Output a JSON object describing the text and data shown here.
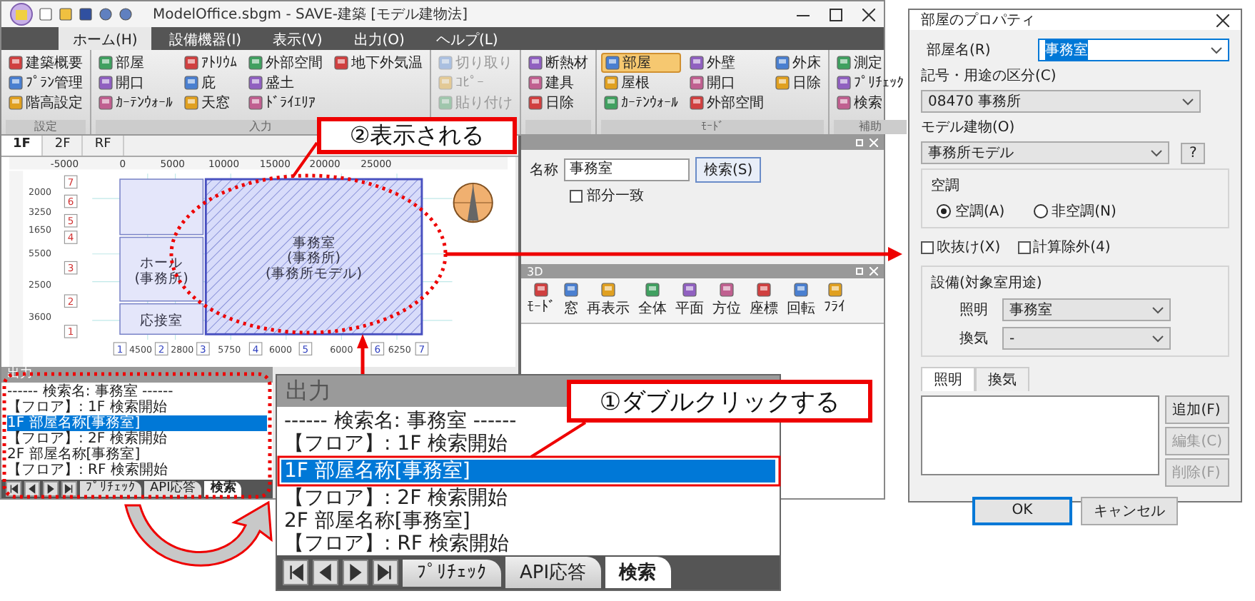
{
  "app": {
    "title": "ModelOffice.sbgm - SAVE-建築 [モデル建物法]",
    "menu_tabs": [
      {
        "label": "ホーム(H)",
        "selected": true
      },
      {
        "label": "設備機器(I)",
        "selected": false
      },
      {
        "label": "表示(V)",
        "selected": false
      },
      {
        "label": "出力(O)",
        "selected": false
      },
      {
        "label": "ヘルプ(L)",
        "selected": false
      }
    ],
    "ribbon": [
      {
        "label": "設定",
        "disabled": false,
        "items": [
          {
            "label": "建築概要"
          },
          {
            "label": "ﾌﾟﾗﾝ管理"
          },
          {
            "label": "階高設定"
          }
        ]
      },
      {
        "label": "入力",
        "disabled": false,
        "items": [
          {
            "label": "部屋"
          },
          {
            "label": "開口"
          },
          {
            "label": "ｶｰﾃﾝｳｫｰﾙ"
          },
          {
            "label": "ｱﾄﾘｳﾑ"
          },
          {
            "label": "庇"
          },
          {
            "label": "天窓"
          },
          {
            "label": "外部空間"
          },
          {
            "label": "盛土"
          },
          {
            "label": "ﾄﾞﾗｲｴﾘｱ"
          },
          {
            "label": "地下外気温"
          }
        ]
      },
      {
        "disabled": true,
        "items": [
          {
            "label": "切り取り"
          },
          {
            "label": "ｺﾋﾟｰ"
          },
          {
            "label": "貼り付け"
          }
        ]
      },
      {
        "disabled": false,
        "items": [
          {
            "label": "断熱材"
          },
          {
            "label": "建具"
          },
          {
            "label": "日除"
          }
        ]
      },
      {
        "label": "ﾓｰﾄﾞ",
        "disabled": false,
        "items": [
          {
            "label": "部屋",
            "selected": true
          },
          {
            "label": "屋根",
            "selected": false
          },
          {
            "label": "ｶｰﾃﾝｳｫｰﾙ",
            "selected": false
          },
          {
            "label": "外壁",
            "selected": false
          },
          {
            "label": "開口",
            "selected": false
          },
          {
            "label": "外部空間",
            "selected": false
          },
          {
            "label": "外床",
            "selected": false
          },
          {
            "label": "日除",
            "selected": false
          }
        ]
      },
      {
        "label": "補助",
        "disabled": false,
        "items": [
          {
            "label": "測定"
          },
          {
            "label": "ﾌﾟﾘﾁｪｯｸ"
          },
          {
            "label": "検索"
          }
        ]
      }
    ],
    "floor_tabs": [
      {
        "label": "1F",
        "selected": true
      },
      {
        "label": "2F",
        "selected": false
      },
      {
        "label": "RF",
        "selected": false
      }
    ],
    "plan": {
      "ruler": [
        "-5000",
        "0",
        "5000",
        "10000",
        "15000",
        "20000",
        "25000"
      ],
      "row_markers": [
        "7",
        "6",
        "5",
        "4",
        "3",
        "2",
        "1"
      ],
      "row_dims": [
        "2000",
        "3250",
        "1650",
        "5500",
        "2500",
        "3600"
      ],
      "col_markers": [
        "1",
        "2",
        "3",
        "4",
        "5",
        "6",
        "7"
      ],
      "col_dims": [
        "4500",
        "2800",
        "5750",
        "6000",
        "6000",
        "6250"
      ],
      "rooms": [
        {
          "selected": false
        },
        {
          "labels": [
            "ホール",
            "(事務所)"
          ],
          "selected": false
        },
        {
          "labels": [
            "応接室"
          ],
          "selected": false
        },
        {
          "labels": [
            "事務室",
            "(事務所)",
            "(事務所モデル)"
          ],
          "selected": true
        }
      ]
    },
    "output_panel": {
      "title": "出力",
      "lines": [
        {
          "text": "------ 検索名: 事務室 ------",
          "selected": false
        },
        {
          "text": "【フロア】: 1F 検索開始",
          "selected": false
        },
        {
          "text": "1F 部屋名称[事務室]",
          "selected": true
        },
        {
          "text": "【フロア】: 2F 検索開始",
          "selected": false
        },
        {
          "text": "2F 部屋名称[事務室]",
          "selected": false
        },
        {
          "text": "【フロア】: RF 検索開始",
          "selected": false
        }
      ],
      "tabs": [
        {
          "label": "ﾌﾟﾘﾁｪｯｸ",
          "selected": false
        },
        {
          "label": "API応答",
          "selected": false
        },
        {
          "label": "検索",
          "selected": true
        }
      ]
    },
    "search_pane": {
      "label": "名称",
      "value": "事務室",
      "button": "検索(S)",
      "option": {
        "label": "部分一致",
        "checked": false
      }
    },
    "view_3d": {
      "title": "3D",
      "tools": [
        "ﾓｰﾄﾞ",
        "窓",
        "再表示",
        "全体",
        "平面",
        "方位",
        "座標",
        "回転",
        "ﾌﾗｲ"
      ]
    }
  },
  "output_zoom": {
    "title": "出力",
    "lines": [
      {
        "text": "------ 検索名: 事務室 ------",
        "selected": false
      },
      {
        "text": "【フロア】: 1F 検索開始",
        "selected": false
      },
      {
        "text": "1F 部屋名称[事務室]",
        "selected": true
      },
      {
        "text": "【フロア】: 2F 検索開始",
        "selected": false
      },
      {
        "text": "2F 部屋名称[事務室]",
        "selected": false
      },
      {
        "text": "【フロア】: RF 検索開始",
        "selected": false
      }
    ],
    "tabs": [
      {
        "label": "ﾌﾟﾘﾁｪｯｸ",
        "selected": false
      },
      {
        "label": "API応答",
        "selected": false
      },
      {
        "label": "検索",
        "selected": true
      }
    ]
  },
  "dialog": {
    "title": "部屋のプロパティ",
    "room_name": {
      "label": "部屋名(R)",
      "value": "事務室"
    },
    "category": {
      "label": "記号・用途の区分(C)",
      "value": "08470 事務所"
    },
    "model": {
      "label": "モデル建物(O)",
      "value": "事務所モデル",
      "help": "?"
    },
    "hvac": {
      "label": "空調",
      "options": [
        {
          "label": "空調(A)",
          "selected": true
        },
        {
          "label": "非空調(N)",
          "selected": false
        }
      ]
    },
    "flags": [
      {
        "label": "吹抜け(X)",
        "checked": false
      },
      {
        "label": "計算除外(4)",
        "checked": false
      }
    ],
    "equipment": {
      "label": "設備(対象室用途)",
      "fields": [
        {
          "label": "照明",
          "value": "事務室"
        },
        {
          "label": "換気",
          "value": "-"
        }
      ]
    },
    "tabs": [
      {
        "label": "照明",
        "selected": true
      },
      {
        "label": "換気",
        "selected": false
      }
    ],
    "side_buttons": [
      {
        "label": "追加(F)",
        "disabled": false
      },
      {
        "label": "編集(C)",
        "disabled": true
      },
      {
        "label": "削除(F)",
        "disabled": true
      }
    ],
    "buttons": [
      {
        "label": "OK",
        "default": true
      },
      {
        "label": "キャンセル",
        "default": false
      }
    ]
  },
  "callouts": [
    {
      "text": "②表示される"
    },
    {
      "text": "①ダブルクリックする"
    }
  ]
}
